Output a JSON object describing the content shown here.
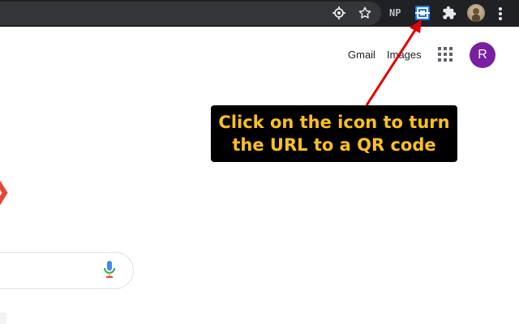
{
  "browser": {
    "toolbar_icons": [
      "location-icon",
      "star-icon",
      "qr-code-icon",
      "extensions-icon",
      "more-menu-icon"
    ],
    "np_extension_label": "NP",
    "accent": "#1a73e8"
  },
  "google": {
    "gmail_label": "Gmail",
    "images_label": "Images",
    "account_initial": "R",
    "account_color": "#7b1fa2"
  },
  "callout": {
    "line1": "Click on the icon to turn",
    "line2": "the URL to a QR code",
    "text_color": "#ffc01e",
    "arrow_color": "#e00000"
  }
}
